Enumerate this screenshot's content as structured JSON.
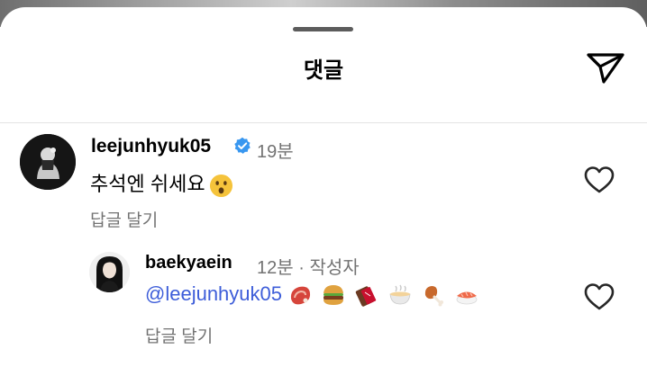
{
  "sheet": {
    "title": "댓글"
  },
  "comments": [
    {
      "username": "leejunhyuk05",
      "verified": true,
      "time": "19분",
      "text": "추석엔 쉬세요",
      "emoji": "astonished-face",
      "reply_label": "답글 달기"
    }
  ],
  "reply": {
    "username": "baekyaein",
    "time": "12분",
    "separator": "·",
    "author_badge": "작성자",
    "mention": "@leejunhyuk05",
    "emojis": [
      "cut-of-meat",
      "hamburger",
      "chocolate-bar",
      "steaming-bowl",
      "poultry-leg",
      "sushi"
    ],
    "reply_label": "답글 달기"
  },
  "colors": {
    "verified": "#3897f0",
    "mention": "#3d5dd9",
    "secondary_text": "#737373",
    "divider": "#e3e3e3"
  }
}
